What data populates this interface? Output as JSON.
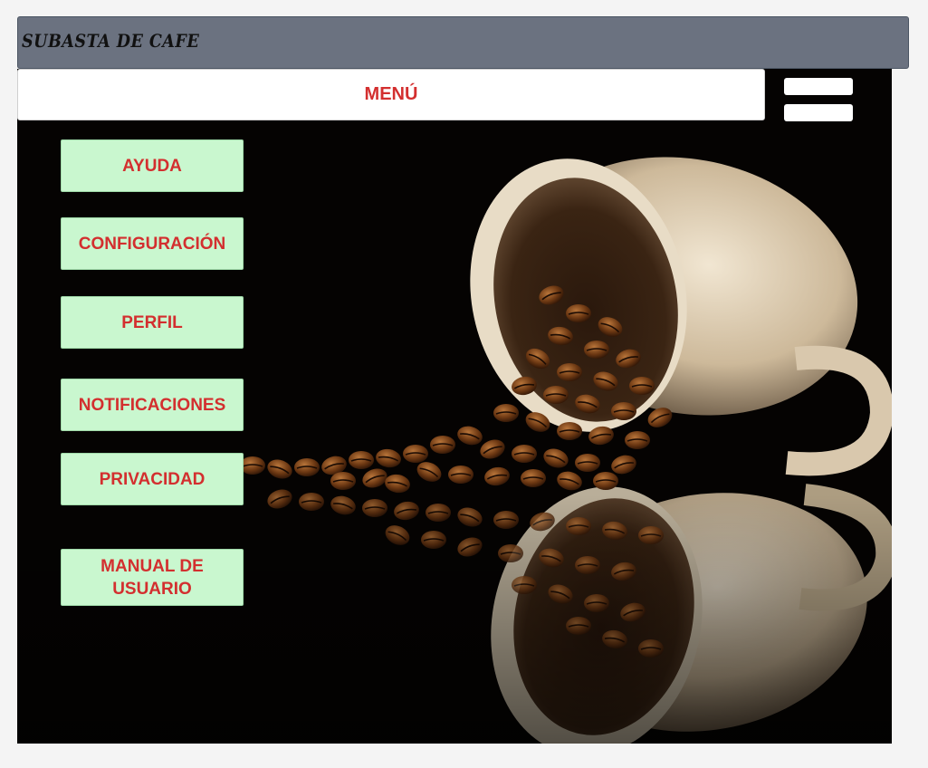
{
  "app": {
    "title": "SUBASTA DE CAFE"
  },
  "header": {
    "menu_label": "MENÚ",
    "hamburger_icon": "hamburger-menu-icon"
  },
  "menu": {
    "items": [
      {
        "label": "AYUDA"
      },
      {
        "label": "CONFIGURACIÓN"
      },
      {
        "label": "PERFIL"
      },
      {
        "label": "NOTIFICACIONES"
      },
      {
        "label": "PRIVACIDAD"
      },
      {
        "label": "MANUAL DE USUARIO"
      }
    ]
  },
  "background": {
    "image": "coffee-cup-beans-image"
  },
  "colors": {
    "titlebar": "#6b7280",
    "menu_text": "#d32f2f",
    "button_bg": "#c9f7cf",
    "canvas_bg": "#050302"
  }
}
